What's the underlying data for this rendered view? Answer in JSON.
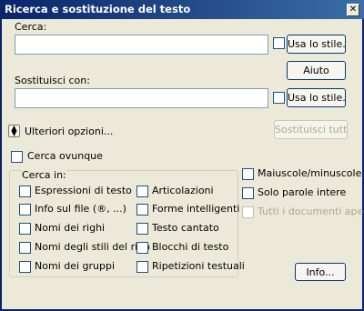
{
  "window": {
    "title": "Ricerca e sostituzione del testo"
  },
  "search": {
    "label": "Cerca:",
    "value": "",
    "use_style_label": "Usa lo stile..."
  },
  "replace": {
    "label": "Sostituisci con:",
    "value": "",
    "use_style_label": "Usa lo stile..."
  },
  "buttons": {
    "help": "Aiuto",
    "replace_all": "Sostituisci tutto",
    "info": "Info..."
  },
  "more_options": {
    "label": "Ulteriori opzioni..."
  },
  "search_everywhere": {
    "label": "Cerca ovunque"
  },
  "search_in": {
    "title": "Cerca in:",
    "left": [
      "Espressioni di testo",
      "Info sul file (®, ...)",
      "Nomi dei righi",
      "Nomi degli stili del rigo",
      "Nomi dei gruppi"
    ],
    "right": [
      "Articolazioni",
      "Forme intelligenti",
      "Testo cantato",
      "Blocchi di testo",
      "Ripetizioni testuali"
    ]
  },
  "options": {
    "match_case": "Maiuscole/minuscole",
    "whole_words": "Solo parole intere",
    "all_documents": "Tutti i documenti aperti"
  }
}
